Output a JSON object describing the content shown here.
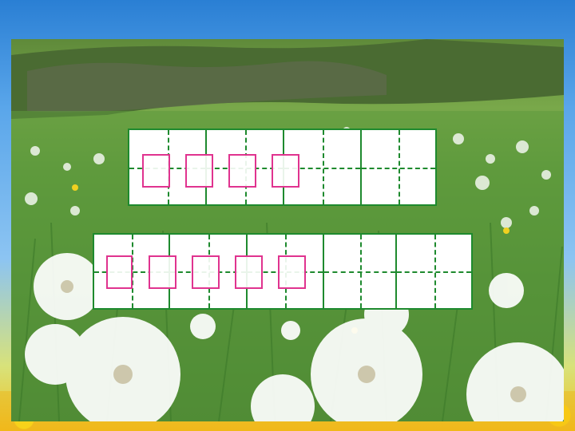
{
  "slide": {
    "background": "sky-blue-gradient",
    "photo": "dandelion-meadow"
  },
  "writing_grid_1": {
    "cells": 8,
    "answer_boxes": 4,
    "line_color": "#1e8a2e",
    "answer_box_color": "#e0338f"
  },
  "writing_grid_2": {
    "cells": 10,
    "answer_boxes": 5,
    "line_color": "#1e8a2e",
    "answer_box_color": "#e0338f"
  }
}
